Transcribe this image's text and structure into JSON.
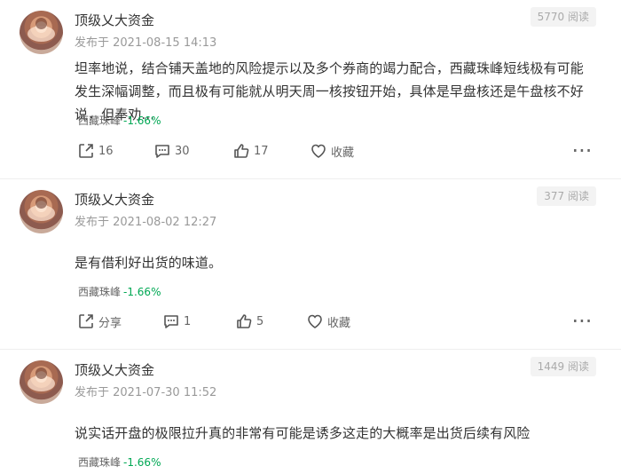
{
  "posts": [
    {
      "author": "顶级乂大资金",
      "date": "发布于 2021-08-15 14:13",
      "reads": "5770 阅读",
      "content": "坦率地说，结合铺天盖地的风险提示以及多个券商的竭力配合，西藏珠峰短线极有可能发生深幅调整，而且极有可能就从明天周一核按钮开始，具体是早盘核还是午盘核不好说，但奉劝...",
      "tag": "西藏珠峰",
      "change": "-1.66%",
      "share": "16",
      "comments": "30",
      "likes": "17",
      "collect": "收藏"
    },
    {
      "author": "顶级乂大资金",
      "date": "发布于 2021-08-02 12:27",
      "reads": "377 阅读",
      "content": "是有借利好出货的味道。",
      "tag": "西藏珠峰",
      "change": "-1.66%",
      "share": "分享",
      "comments": "1",
      "likes": "5",
      "collect": "收藏"
    },
    {
      "author": "顶级乂大资金",
      "date": "发布于 2021-07-30 11:52",
      "reads": "1449 阅读",
      "content": "说实话开盘的极限拉升真的非常有可能是诱多这走的大概率是出货后续有风险",
      "tag": "西藏珠峰",
      "change": "-1.66%"
    }
  ],
  "icons": {
    "share": "share-icon",
    "comment": "comment-icon",
    "like": "thumbs-up-icon",
    "collect": "heart-icon",
    "more": "more-icon"
  },
  "colors": {
    "negative_change": "#00a854",
    "meta": "#999999",
    "divider": "#efefef"
  }
}
